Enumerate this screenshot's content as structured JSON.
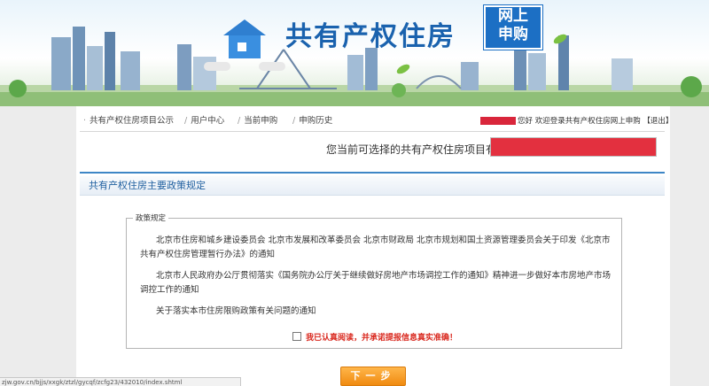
{
  "banner": {
    "title": "共有产权住房",
    "badge_line1": "网上",
    "badge_line2": "申购"
  },
  "nav": {
    "items": [
      {
        "label": "共有产权住房项目公示"
      },
      {
        "label": "用户中心"
      },
      {
        "label": "当前申购"
      },
      {
        "label": "申购历史"
      }
    ]
  },
  "user_bar": {
    "greeting": "您好 欢迎登录共有产权住房网上申购",
    "logout": "【退出】"
  },
  "project_select": {
    "label": "您当前可选择的共有产权住房项目有："
  },
  "section": {
    "title": "共有产权住房主要政策规定"
  },
  "policy": {
    "legend": "政策规定",
    "links": [
      {
        "text": "北京市住房和城乡建设委员会 北京市发展和改革委员会 北京市财政局 北京市规划和国土资源管理委员会关于印发《北京市共有产权住房管理暂行办法》的通知"
      },
      {
        "text": "北京市人民政府办公厅贯彻落实《国务院办公厅关于继续做好房地产市场调控工作的通知》精神进一步做好本市房地产市场调控工作的通知"
      },
      {
        "text": "关于落实本市住房限购政策有关问题的通知"
      }
    ]
  },
  "confirm": {
    "text": "我已认真阅读，并承诺提报信息真实准确！",
    "checked": false
  },
  "next_button": {
    "label": "下一步"
  },
  "status_bar": {
    "url": "zjw.gov.cn/bjjs/xxgk/ztzl/gycqf/zcfg23/432010/index.shtml"
  },
  "colors": {
    "brand_blue": "#1a62ae",
    "accent_red": "#d9271d",
    "button_orange": "#f08a10"
  }
}
